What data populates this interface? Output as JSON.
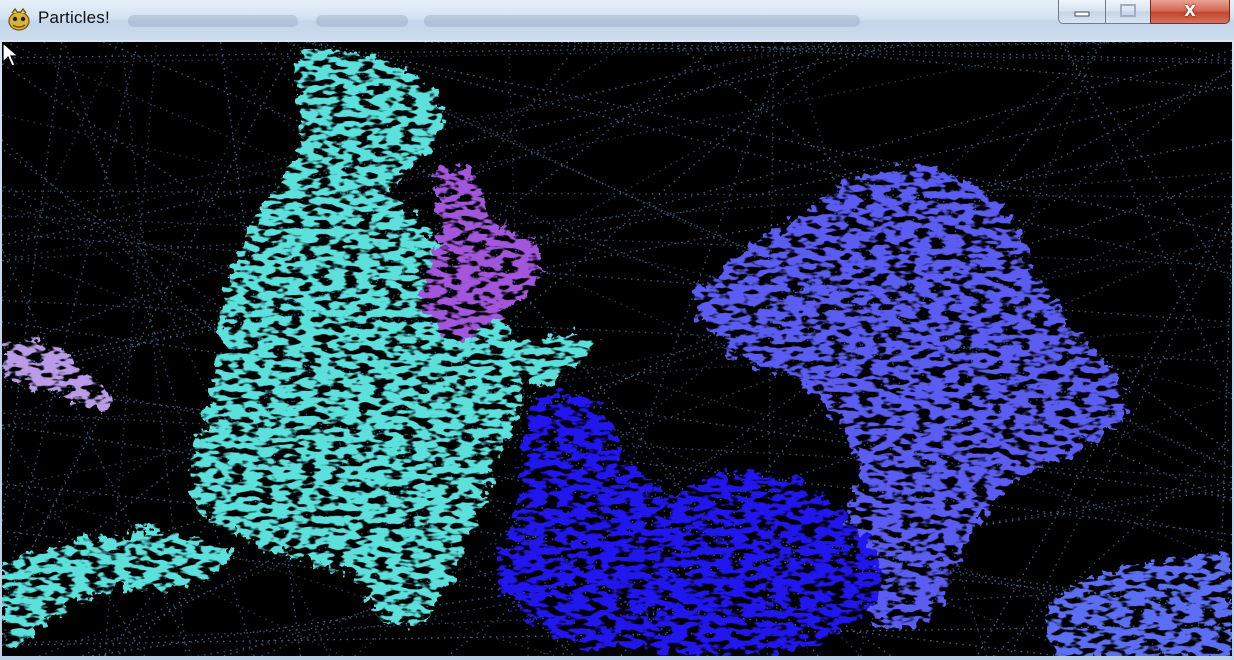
{
  "window": {
    "title": "Particles!",
    "app_icon": "pygame-snake-icon",
    "controls": {
      "minimize_icon": "minimize-icon",
      "maximize_icon": "maximize-icon",
      "close_icon": "close-icon",
      "close_glyph": "X"
    }
  },
  "scene": {
    "background": "#000000",
    "trail_color": "#3a6f96",
    "clusters": [
      {
        "name": "cyan-cluster",
        "color": "#5ce0dc"
      },
      {
        "name": "violet-cluster",
        "color": "#a257dc"
      },
      {
        "name": "lavender-cluster",
        "color": "#b99be8"
      },
      {
        "name": "periwinkle-cluster",
        "color": "#5a5cf2"
      },
      {
        "name": "blue-cluster",
        "color": "#2017ee"
      },
      {
        "name": "corner-blue-cluster",
        "color": "#5b6ef4"
      }
    ]
  },
  "cursor_icon": "mouse-pointer-icon"
}
